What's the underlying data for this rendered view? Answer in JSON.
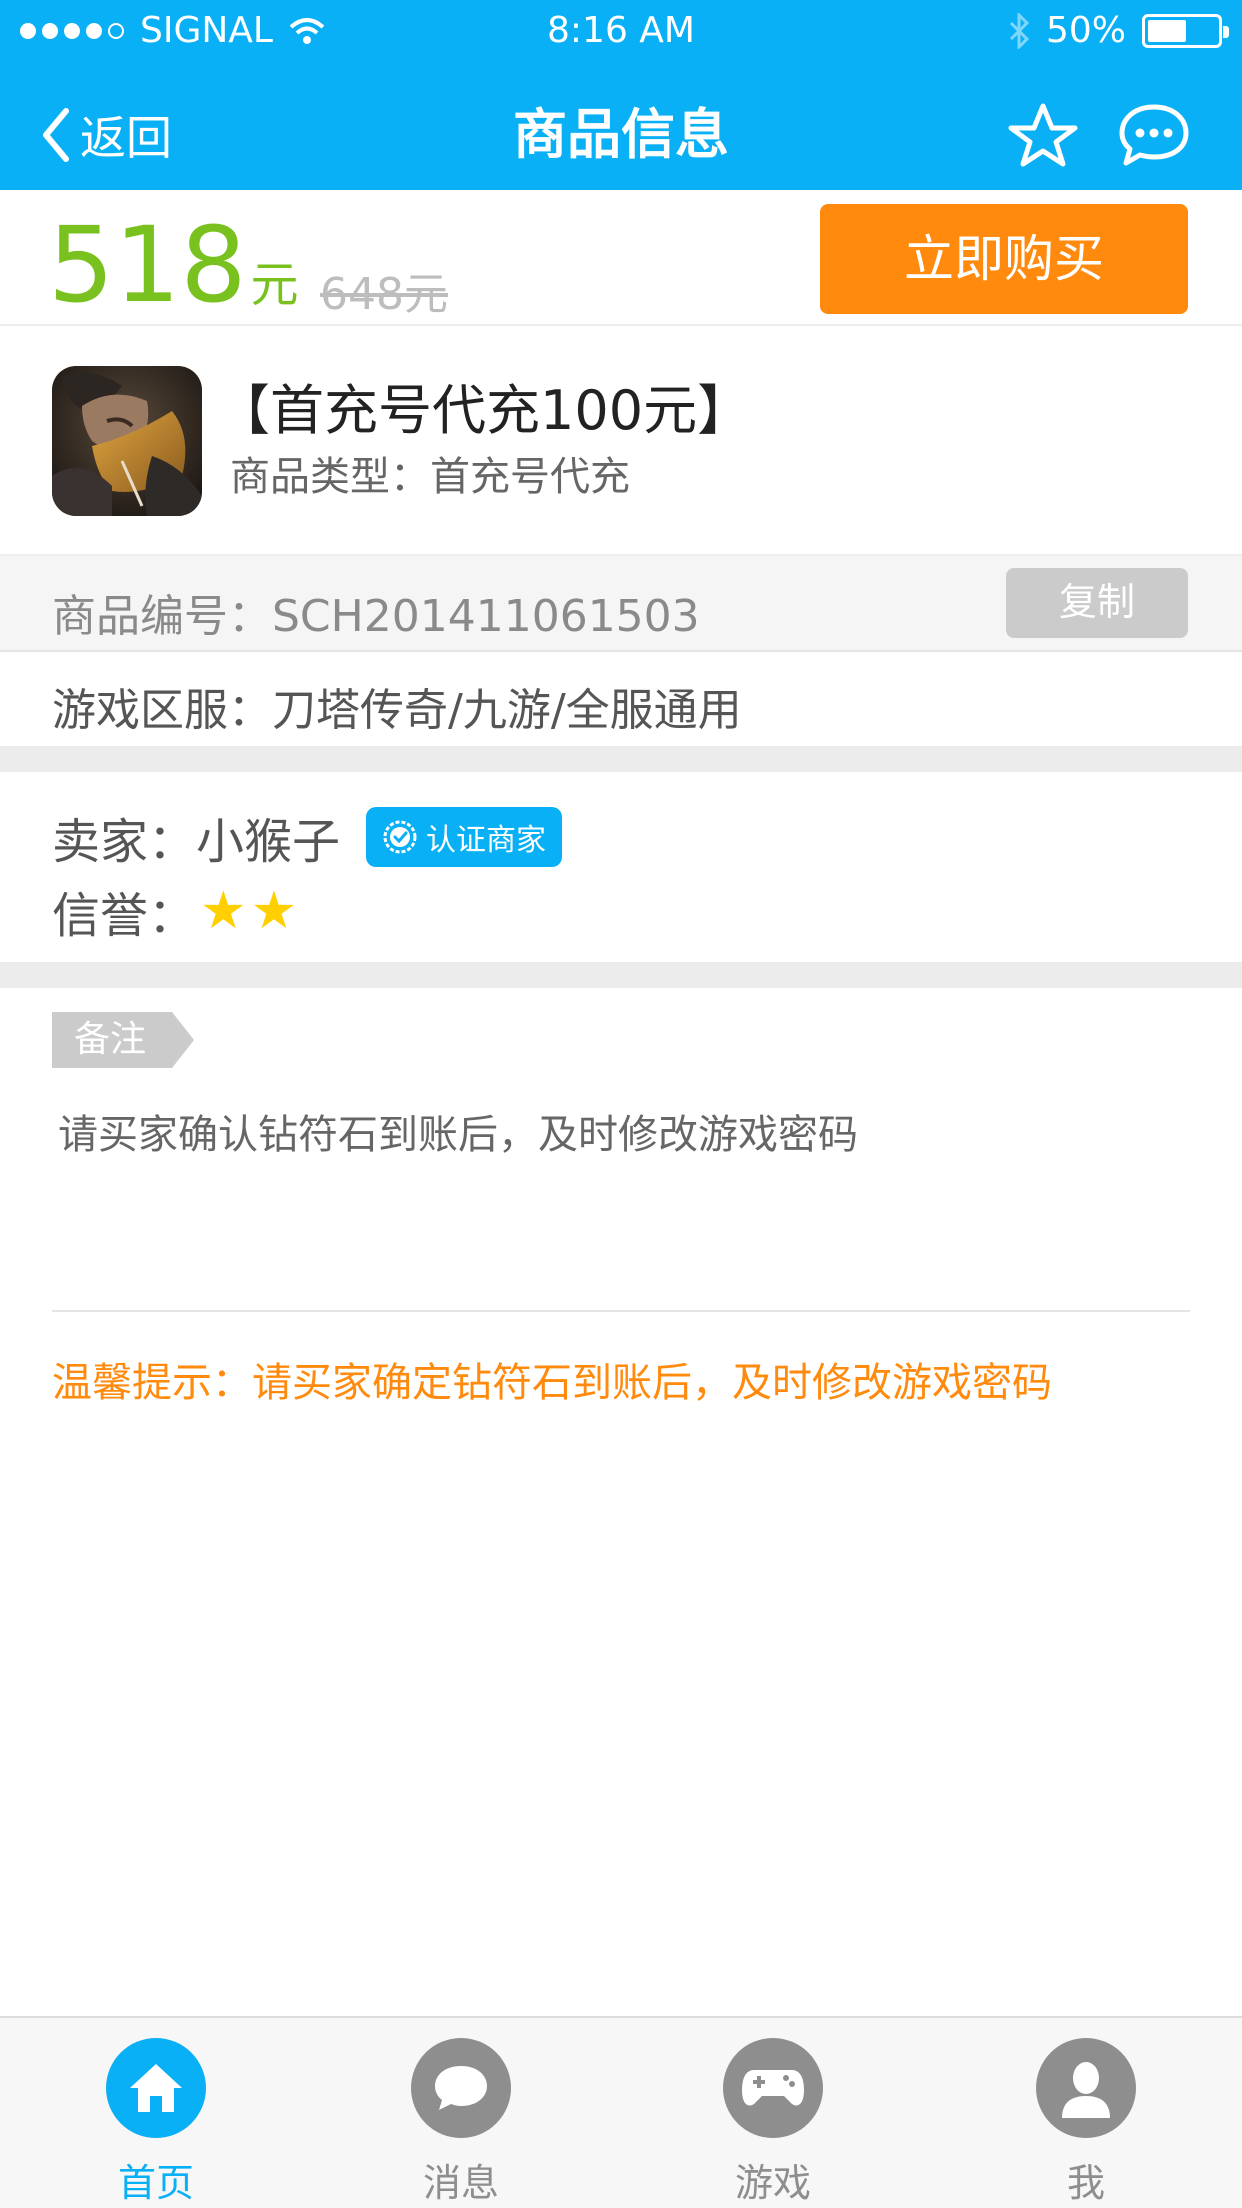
{
  "status_bar": {
    "carrier": "SIGNAL",
    "time": "8:16 AM",
    "battery_percent": "50%",
    "battery_level": 0.5
  },
  "nav": {
    "back_label": "返回",
    "title": "商品信息"
  },
  "price": {
    "current": "518",
    "current_unit": "元",
    "original": "648元",
    "buy_label": "立即购买"
  },
  "product": {
    "name": "【首充号代充100元】",
    "type": "商品类型：首充号代充"
  },
  "code": {
    "text": "商品编号：SCH201411061503",
    "copy_label": "复制"
  },
  "server": {
    "text": "游戏区服：刀塔传奇/九游/全服通用"
  },
  "seller": {
    "text": "卖家：小猴子",
    "badge": "认证商家",
    "credit_label": "信誉：",
    "credit_stars": "★★",
    "credit_value": 2
  },
  "note": {
    "tag": "备注",
    "text": "请买家确认钻符石到账后，及时修改游戏密码",
    "tip": "温馨提示：请买家确定钻符石到账后，及时修改游戏密码"
  },
  "tabbar": {
    "items": [
      {
        "label": "首页",
        "icon": "home-icon",
        "active": true
      },
      {
        "label": "消息",
        "icon": "message-icon",
        "active": false
      },
      {
        "label": "游戏",
        "icon": "gamepad-icon",
        "active": false
      },
      {
        "label": "我",
        "icon": "user-icon",
        "active": false
      }
    ]
  },
  "colors": {
    "primary": "#09b0f5",
    "price": "#79c11f",
    "accent": "#ff8a0d",
    "star": "#ffcf00",
    "inactive": "#8e8e8e"
  }
}
